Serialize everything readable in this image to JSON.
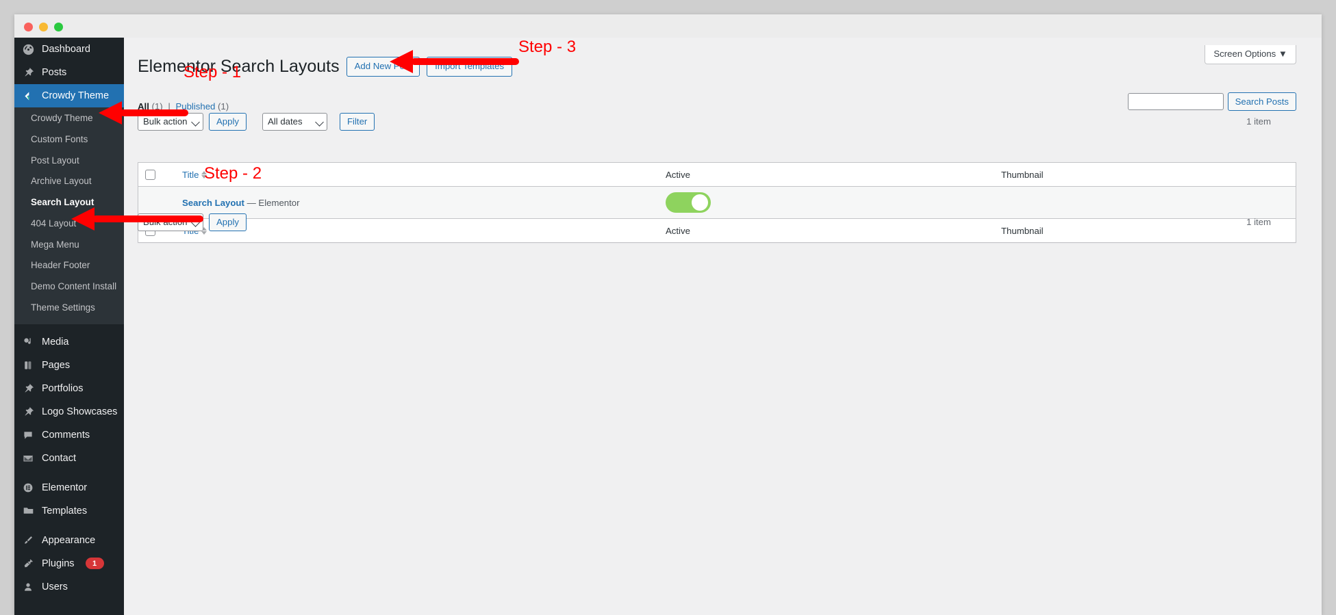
{
  "window": {
    "traffic_lights": [
      "close",
      "minimize",
      "maximize"
    ]
  },
  "sidebar": {
    "items": [
      {
        "label": "Dashboard",
        "icon": "dashboard-icon",
        "current": false
      },
      {
        "label": "Posts",
        "icon": "pin-icon",
        "current": false
      },
      {
        "label": "Crowdy Theme",
        "icon": "crowdy-theme-icon",
        "current": true
      }
    ],
    "submenu": [
      {
        "label": "Crowdy Theme",
        "current": false
      },
      {
        "label": "Custom Fonts",
        "current": false
      },
      {
        "label": "Post Layout",
        "current": false
      },
      {
        "label": "Archive Layout",
        "current": false
      },
      {
        "label": "Search Layout",
        "current": true
      },
      {
        "label": "404 Layout",
        "current": false
      },
      {
        "label": "Mega Menu",
        "current": false
      },
      {
        "label": "Header Footer",
        "current": false
      },
      {
        "label": "Demo Content Install",
        "current": false
      },
      {
        "label": "Theme Settings",
        "current": false
      }
    ],
    "items_after": [
      {
        "label": "Media",
        "icon": "media-icon",
        "badge": ""
      },
      {
        "label": "Pages",
        "icon": "pages-icon",
        "badge": ""
      },
      {
        "label": "Portfolios",
        "icon": "pin-icon",
        "badge": ""
      },
      {
        "label": "Logo Showcases",
        "icon": "pin-icon",
        "badge": ""
      },
      {
        "label": "Comments",
        "icon": "comment-icon",
        "badge": ""
      },
      {
        "label": "Contact",
        "icon": "envelope-icon",
        "badge": ""
      }
    ],
    "items_group3": [
      {
        "label": "Elementor",
        "icon": "elementor-icon",
        "badge": ""
      },
      {
        "label": "Templates",
        "icon": "folder-icon",
        "badge": ""
      }
    ],
    "items_group4": [
      {
        "label": "Appearance",
        "icon": "appearance-brush-icon",
        "badge": ""
      },
      {
        "label": "Plugins",
        "icon": "plugin-icon",
        "badge": "1"
      },
      {
        "label": "Users",
        "icon": "user-icon",
        "badge": ""
      }
    ]
  },
  "screen_meta": {
    "screen_options_label": "Screen Options ▼"
  },
  "header": {
    "title": "Elementor Search Layouts",
    "add_new_label": "Add New Post",
    "import_templates_label": "Import Templates"
  },
  "filters": {
    "all_label": "All",
    "all_count": "(1)",
    "separator": "|",
    "published_label": "Published",
    "published_count": "(1)"
  },
  "search": {
    "value": "",
    "placeholder": "",
    "submit_label": "Search Posts"
  },
  "tablenav_top": {
    "bulk_actions_value": "Bulk actions",
    "apply_label": "Apply",
    "dates_value": "All dates",
    "filter_label": "Filter",
    "displaying_num": "1 item"
  },
  "tablenav_bottom": {
    "bulk_actions_value": "Bulk actions",
    "apply_label": "Apply",
    "displaying_num": "1 item"
  },
  "table": {
    "columns": {
      "title": "Title",
      "active": "Active",
      "thumbnail": "Thumbnail"
    },
    "rows": [
      {
        "title_link": "Search Layout",
        "title_suffix": "— Elementor",
        "active": true,
        "thumbnail": ""
      }
    ]
  },
  "annotations": [
    {
      "label": "Step - 1"
    },
    {
      "label": "Step - 2"
    },
    {
      "label": "Step - 3"
    }
  ],
  "colors": {
    "accent": "#2271b1",
    "sidebar_bg": "#1d2327",
    "submenu_bg": "#2c3338",
    "toggle_on": "#8ed35e",
    "annotation": "#ff0000",
    "badge": "#d63638"
  }
}
